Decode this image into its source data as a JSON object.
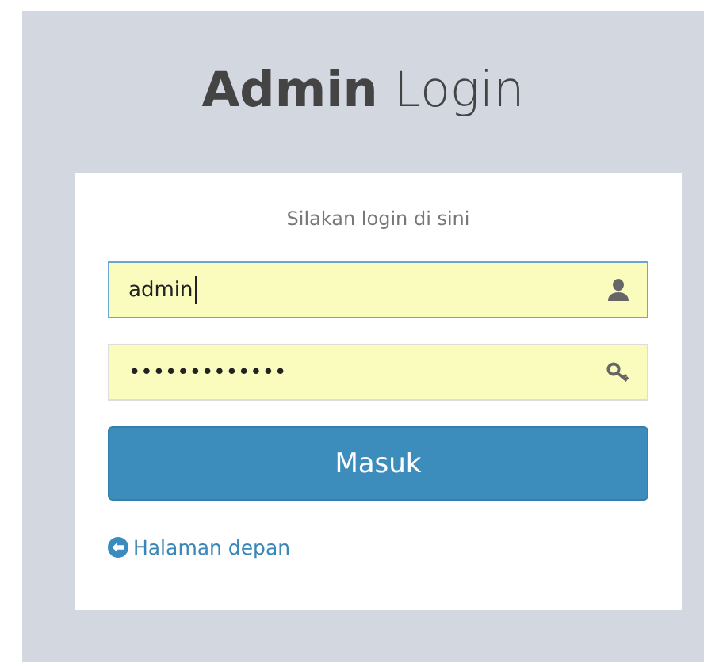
{
  "title": "**Admin** Login",
  "subtitle": "Silakan login di sini",
  "fields": [
    {
      "kind": "user",
      "value": "admin",
      "focused": true
    },
    {
      "kind": "password",
      "value": "•••••••••••••",
      "focused": false
    }
  ],
  "submit": "Masuk",
  "home_link": "Halaman depan"
}
